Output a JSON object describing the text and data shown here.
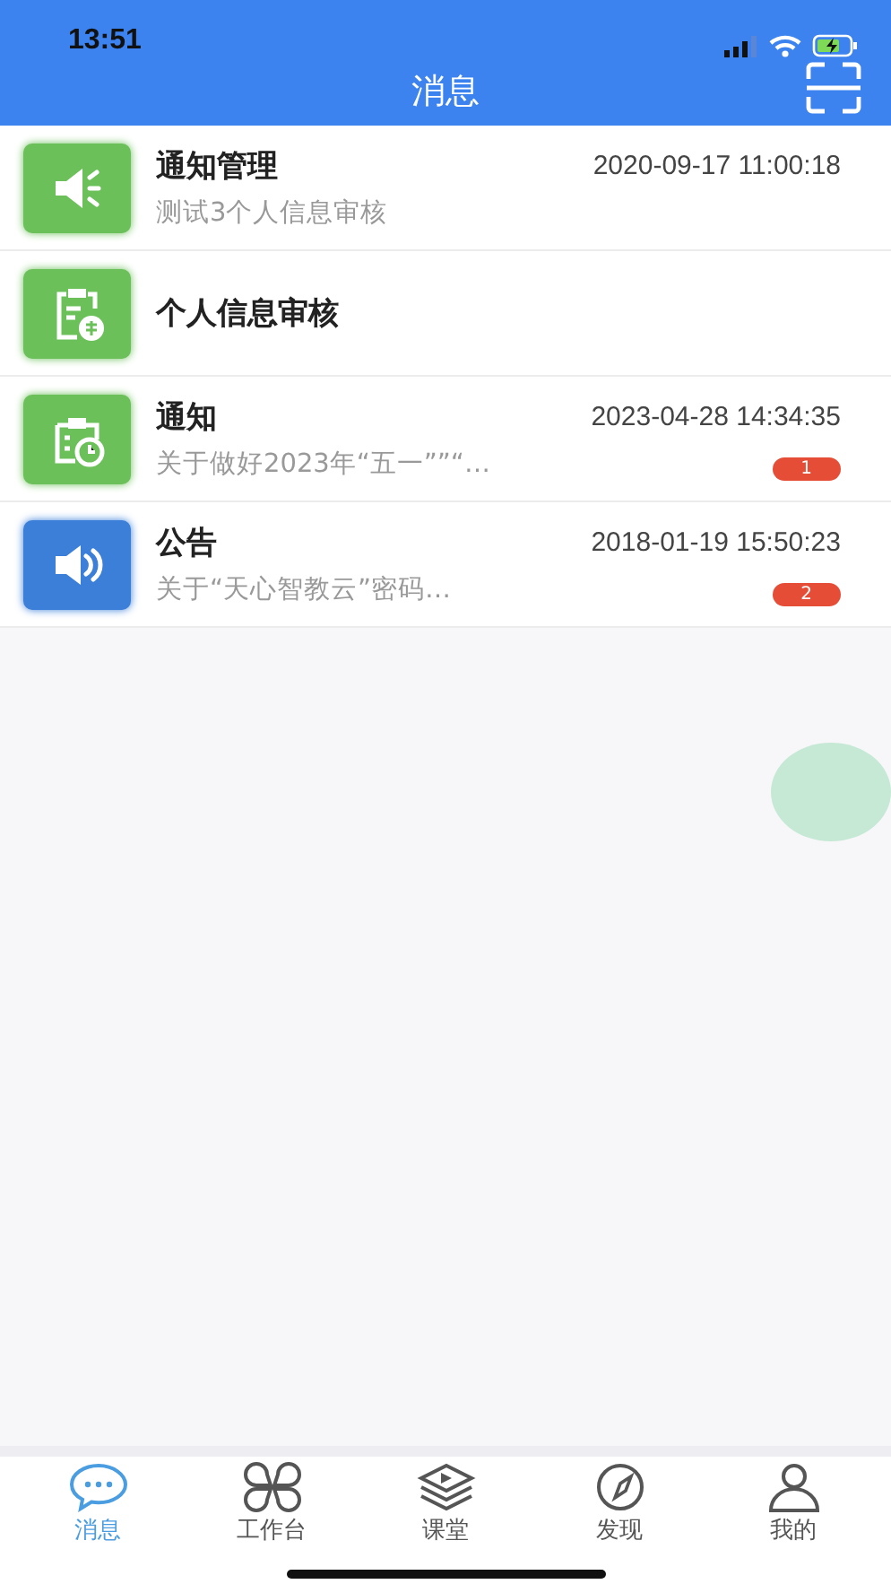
{
  "status_bar": {
    "time": "13:51"
  },
  "nav_bar": {
    "title": "消息"
  },
  "messages": [
    {
      "kind": "megaphone",
      "color": "#6cc05a",
      "title": "通知管理",
      "time": "2020-09-17 11:00:18",
      "preview": "测试3个人信息审核"
    },
    {
      "kind": "clipboard-stamp",
      "color": "#6cc05a",
      "title": "个人信息审核"
    },
    {
      "kind": "clipboard-clock",
      "color": "#6cc05a",
      "title": "通知",
      "time": "2023-04-28 14:34:35",
      "preview": "关于做好2023年“五一””“…",
      "badge": "1"
    },
    {
      "kind": "speaker",
      "color": "#3b7fd9",
      "title": "公告",
      "time": "2018-01-19 15:50:23",
      "preview": "关于“天心智教云”密码…",
      "badge": "2"
    }
  ],
  "tabs": [
    {
      "kind": "chat",
      "label": "消息",
      "selected": true
    },
    {
      "kind": "grid",
      "label": "工作台",
      "selected": false
    },
    {
      "kind": "layers",
      "label": "课堂",
      "selected": false
    },
    {
      "kind": "compass",
      "label": "发现",
      "selected": false
    },
    {
      "kind": "person",
      "label": "我的",
      "selected": false
    }
  ]
}
